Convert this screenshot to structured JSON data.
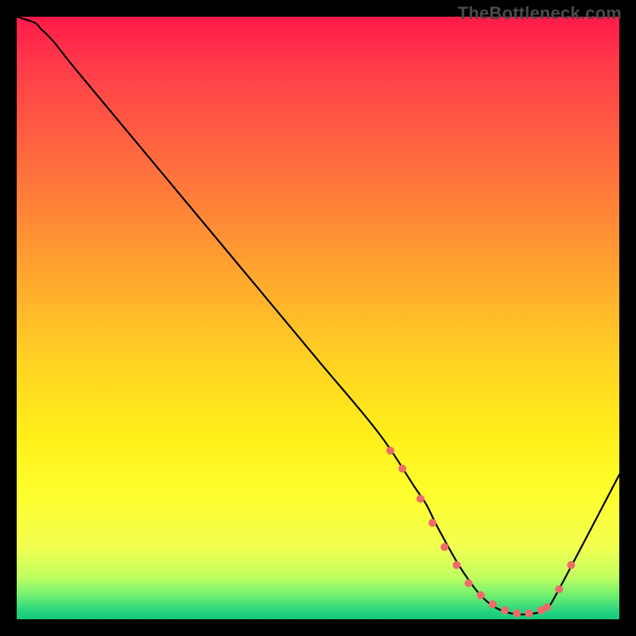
{
  "watermark": "TheBottleneck.com",
  "chart_data": {
    "type": "line",
    "title": "",
    "xlabel": "",
    "ylabel": "",
    "xlim": [
      0,
      100
    ],
    "ylim": [
      0,
      100
    ],
    "background_gradient": {
      "stops": [
        {
          "pct": 0,
          "color": "#ff1a4a"
        },
        {
          "pct": 8,
          "color": "#ff3b4a"
        },
        {
          "pct": 22,
          "color": "#ff6640"
        },
        {
          "pct": 34,
          "color": "#ff8a36"
        },
        {
          "pct": 46,
          "color": "#ffb02c"
        },
        {
          "pct": 58,
          "color": "#ffd422"
        },
        {
          "pct": 70,
          "color": "#fff01a"
        },
        {
          "pct": 80,
          "color": "#feff30"
        },
        {
          "pct": 88,
          "color": "#f2ff50"
        },
        {
          "pct": 93,
          "color": "#c0ff60"
        },
        {
          "pct": 96,
          "color": "#70f070"
        },
        {
          "pct": 99,
          "color": "#1ed080"
        },
        {
          "pct": 100,
          "color": "#17c878"
        }
      ]
    },
    "series": [
      {
        "name": "curve",
        "x": [
          0,
          3,
          4,
          6,
          10,
          20,
          30,
          40,
          50,
          60,
          66,
          68,
          70,
          74,
          78,
          82,
          86,
          88,
          90,
          100
        ],
        "values": [
          100,
          99,
          98,
          96,
          91,
          79,
          67,
          55,
          43,
          31,
          22,
          19,
          15,
          8,
          3,
          1,
          1,
          2,
          5,
          24
        ]
      }
    ],
    "markers": {
      "color": "#f06a6a",
      "radius": 5,
      "points": [
        {
          "x": 62,
          "y": 28
        },
        {
          "x": 64,
          "y": 25
        },
        {
          "x": 67,
          "y": 20
        },
        {
          "x": 69,
          "y": 16
        },
        {
          "x": 71,
          "y": 12
        },
        {
          "x": 73,
          "y": 9
        },
        {
          "x": 75,
          "y": 6
        },
        {
          "x": 77,
          "y": 4
        },
        {
          "x": 79,
          "y": 2.5
        },
        {
          "x": 81,
          "y": 1.5
        },
        {
          "x": 83,
          "y": 1
        },
        {
          "x": 85,
          "y": 1
        },
        {
          "x": 87,
          "y": 1.5
        },
        {
          "x": 88,
          "y": 2
        },
        {
          "x": 90,
          "y": 5
        },
        {
          "x": 92,
          "y": 9
        }
      ]
    }
  }
}
